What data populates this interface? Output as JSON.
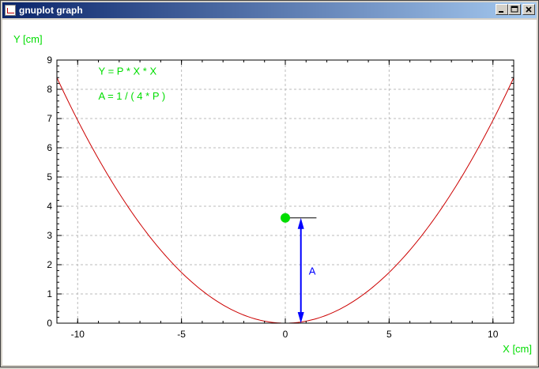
{
  "window": {
    "title": "gnuplot graph",
    "buttons": [
      "minimize",
      "maximize",
      "close"
    ]
  },
  "colors": {
    "curve": "#cc0000",
    "label_green": "#00dd00",
    "arrow_blue": "#0000ff",
    "grid": "#bbbbbb",
    "axis": "#000000"
  },
  "chart_data": {
    "type": "line",
    "title": "",
    "xlabel": "X [cm]",
    "ylabel": "Y [cm]",
    "xlim": [
      -11,
      11
    ],
    "ylim": [
      0,
      9
    ],
    "xticks": [
      -10,
      -5,
      0,
      5,
      10
    ],
    "yticks": [
      0,
      1,
      2,
      3,
      4,
      5,
      6,
      7,
      8,
      9
    ],
    "grid": true,
    "series": [
      {
        "function": "Y = P * X * X",
        "P": 0.0694,
        "x_range": [
          -11,
          11
        ],
        "color": "#cc0000"
      }
    ],
    "annotations": [
      {
        "text": "Y = P * X * X",
        "x": -9,
        "y": 8.5
      },
      {
        "text": "A = 1 / ( 4 * P )",
        "x": -9,
        "y": 7.65
      }
    ],
    "focus_point": {
      "x": 0,
      "y": 3.6,
      "color": "#00dd00"
    },
    "arrow": {
      "x": 0.75,
      "y_from": 0,
      "y_to": 3.6,
      "label": "A",
      "color": "#0000ff"
    },
    "directrix_segment": {
      "x_from": 0,
      "x_to": 1.5,
      "y": 3.6
    }
  }
}
